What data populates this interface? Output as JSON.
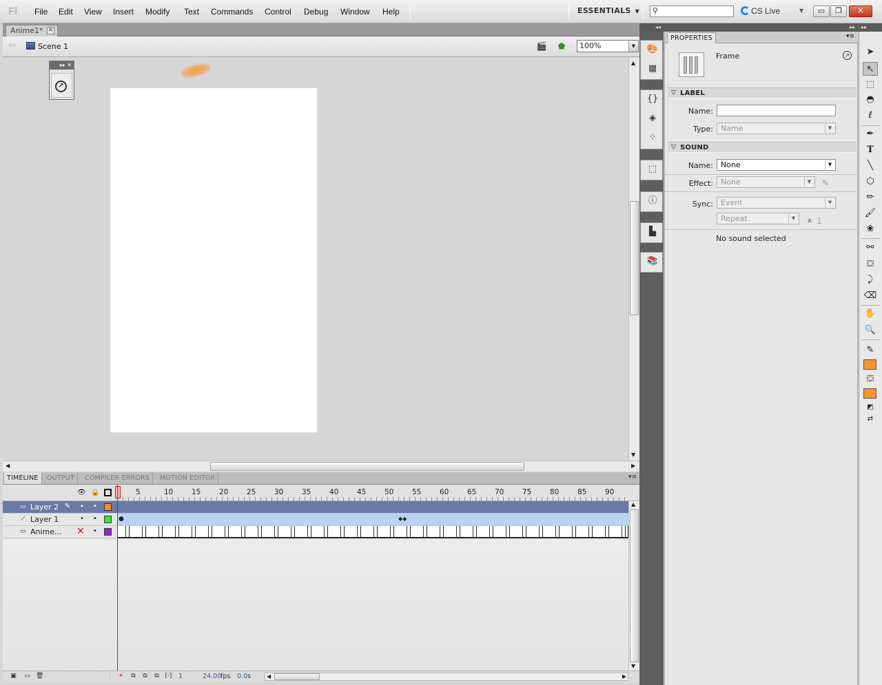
{
  "app": {
    "logo": "Fl"
  },
  "menu": [
    "File",
    "Edit",
    "View",
    "Insert",
    "Modify",
    "Text",
    "Commands",
    "Control",
    "Debug",
    "Window",
    "Help"
  ],
  "workspace": {
    "label": "ESSENTIALS",
    "caret": "▼"
  },
  "search": {
    "value": "",
    "placeholder": ""
  },
  "cs_live": "CS Live",
  "window_controls": {
    "minimize": "▭",
    "restore": "❐",
    "close": "✕"
  },
  "document": {
    "tab_title": "Anime1*",
    "scene": "Scene 1",
    "zoom": "100%"
  },
  "timeline": {
    "tabs": [
      "TIMELINE",
      "OUTPUT",
      "COMPILER ERRORS",
      "MOTION EDITOR"
    ],
    "frame_numbers": [
      "5",
      "10",
      "15",
      "20",
      "25",
      "30",
      "35",
      "40",
      "45",
      "50",
      "55",
      "60",
      "65",
      "70",
      "75",
      "80",
      "85",
      "90"
    ],
    "layers": [
      {
        "name": "Layer 2",
        "selected": true,
        "color": "#f7922a"
      },
      {
        "name": "Layer 1",
        "selected": false,
        "color": "#39e33b"
      },
      {
        "name": "Anime...",
        "selected": false,
        "color": "#8d2fc9"
      }
    ],
    "footer": {
      "current_frame": "1",
      "fps": "24.00",
      "fps_unit": "fps",
      "time": "0.0",
      "time_unit": "s"
    }
  },
  "properties": {
    "tab": "PROPERTIES",
    "type": "Frame",
    "label_section": {
      "title": "LABEL",
      "name_label": "Name:",
      "name_value": "",
      "type_label": "Type:",
      "type_value": "Name"
    },
    "sound_section": {
      "title": "SOUND",
      "name_label": "Name:",
      "name_value": "None",
      "effect_label": "Effect:",
      "effect_value": "None",
      "sync_label": "Sync:",
      "sync_value": "Event",
      "repeat_value": "Repeat",
      "times_symbol": "x",
      "repeat_count": "1",
      "status": "No sound selected"
    }
  },
  "colors": {
    "stroke": "#f7942e",
    "fill": "#f7942e",
    "layer_selected_bg": "#6b7aa8",
    "playhead": "#d01818"
  }
}
